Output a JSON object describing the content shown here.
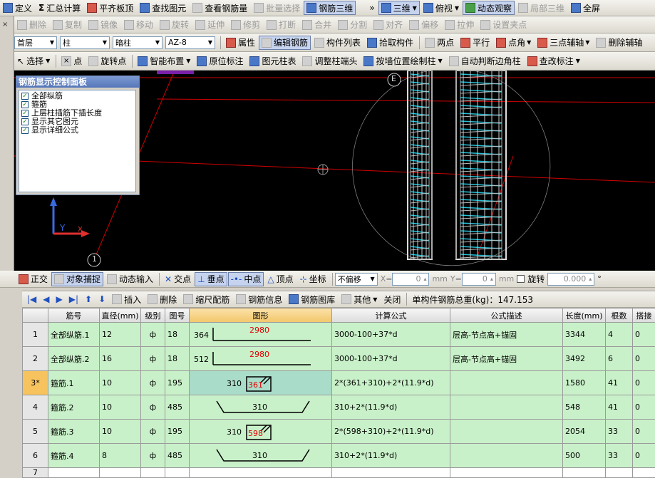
{
  "toolbar1": {
    "items": [
      "定义",
      "汇总计算",
      "平齐板顶",
      "查找图元",
      "查看钢筋量",
      "批量选择",
      "钢筋三维",
      "三维",
      "俯视",
      "动态观察",
      "局部三维",
      "全屏"
    ],
    "overflow_glyph": "»"
  },
  "toolbar2": {
    "items": [
      "删除",
      "复制",
      "镜像",
      "移动",
      "旋转",
      "延伸",
      "修剪",
      "打断",
      "合并",
      "分割",
      "对齐",
      "偏移",
      "拉伸",
      "设置夹点"
    ]
  },
  "toolbar3": {
    "floor": "首层",
    "type": "柱",
    "subtype": "暗柱",
    "name": "AZ-8",
    "items": [
      "属性",
      "编辑钢筋",
      "构件列表",
      "拾取构件",
      "两点",
      "平行",
      "点角",
      "三点辅轴",
      "删除辅轴"
    ]
  },
  "toolbar4": {
    "items": [
      "选择",
      "点",
      "旋转点",
      "智能布置",
      "原位标注",
      "图元柱表",
      "调整柱端头",
      "按墙位置绘制柱",
      "自动判断边角柱",
      "查改标注"
    ]
  },
  "panel": {
    "title": "钢筋显示控制面板",
    "options": [
      "全部纵筋",
      "箍筋",
      "上层柱插筋下插长度",
      "显示其它图元",
      "显示详细公式"
    ]
  },
  "viewport": {
    "axis_label_e": "E",
    "axis_label_1": "1",
    "coord_x": "X",
    "coord_y": "Y"
  },
  "snapbar": {
    "items": [
      "正交",
      "对象捕捉",
      "动态输入",
      "交点",
      "垂点",
      "中点",
      "顶点",
      "坐标"
    ],
    "offset_mode": "不偏移",
    "x_label": "X=",
    "x_value": "0",
    "y_label": "Y=",
    "y_value": "0",
    "unit": "mm",
    "rotate_label": "旋转",
    "rotate_value": "0.000",
    "degree": "°"
  },
  "tablebar": {
    "items": [
      "插入",
      "删除",
      "缩尺配筋",
      "钢筋信息",
      "钢筋图库",
      "其他",
      "关闭"
    ],
    "total_weight_label": "单构件钢筋总重(kg)：147.153"
  },
  "table": {
    "headers": [
      "筋号",
      "直径(mm)",
      "级别",
      "图号",
      "图形",
      "计算公式",
      "公式描述",
      "长度(mm)",
      "根数",
      "搭接"
    ],
    "rows": [
      {
        "no": "1",
        "name": "全部纵筋.1",
        "dia": "12",
        "grade": "ф",
        "fig": "18",
        "shape_left": "364",
        "shape_top": "2980",
        "formula": "3000-100+37*d",
        "desc": "层高-节点高+锚固",
        "len": "3344",
        "count": "4",
        "lap": "0"
      },
      {
        "no": "2",
        "name": "全部纵筋.2",
        "dia": "16",
        "grade": "ф",
        "fig": "18",
        "shape_left": "512",
        "shape_top": "2980",
        "formula": "3000-100+37*d",
        "desc": "层高-节点高+锚固",
        "len": "3492",
        "count": "6",
        "lap": "0"
      },
      {
        "no": "3*",
        "name": "箍筋.1",
        "dia": "10",
        "grade": "ф",
        "fig": "195",
        "shape_left": "310",
        "shape_top": "361",
        "formula": "2*(361+310)+2*(11.9*d)",
        "desc": "",
        "len": "1580",
        "count": "41",
        "lap": "0"
      },
      {
        "no": "4",
        "name": "箍筋.2",
        "dia": "10",
        "grade": "ф",
        "fig": "485",
        "shape_left": "",
        "shape_top": "310",
        "formula": "310+2*(11.9*d)",
        "desc": "",
        "len": "548",
        "count": "41",
        "lap": "0"
      },
      {
        "no": "5",
        "name": "箍筋.3",
        "dia": "10",
        "grade": "ф",
        "fig": "195",
        "shape_left": "310",
        "shape_top": "598",
        "formula": "2*(598+310)+2*(11.9*d)",
        "desc": "",
        "len": "2054",
        "count": "33",
        "lap": "0"
      },
      {
        "no": "6",
        "name": "箍筋.4",
        "dia": "8",
        "grade": "ф",
        "fig": "485",
        "shape_left": "",
        "shape_top": "310",
        "formula": "310+2*(11.9*d)",
        "desc": "",
        "len": "500",
        "count": "33",
        "lap": "0"
      },
      {
        "no": "7",
        "name": "",
        "dia": "",
        "grade": "",
        "fig": "",
        "shape_left": "",
        "shape_top": "",
        "formula": "",
        "desc": "",
        "len": "",
        "count": "",
        "lap": ""
      }
    ]
  },
  "colors": {
    "row_bg": "#c9f1c9",
    "header_highlight": "#f2c66b",
    "viewport_bg": "#000000",
    "red_dim": "#e00000"
  }
}
